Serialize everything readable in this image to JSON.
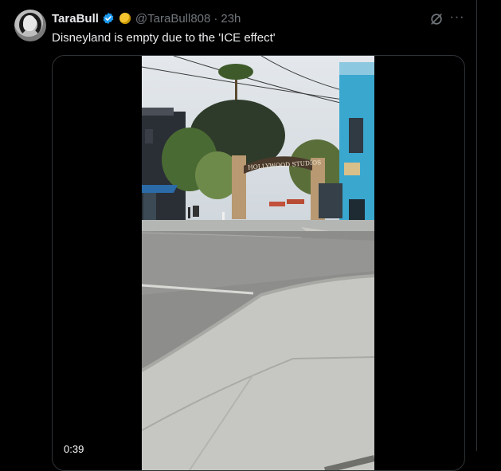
{
  "tweet": {
    "display_name": "TaraBull",
    "handle": "@TaraBull808",
    "separator": "·",
    "time": "23h",
    "text": "Disneyland is empty due to the 'ICE effect'",
    "more_label": "···"
  },
  "media": {
    "duration": "0:39",
    "scene": {
      "arch_sign": "HOLLYWOOD STUDIOS"
    }
  },
  "colors": {
    "background": "#000000",
    "text_primary": "#e7e9ea",
    "text_secondary": "#71767b",
    "verified_blue": "#1d9bf0",
    "border": "#2f3336"
  }
}
